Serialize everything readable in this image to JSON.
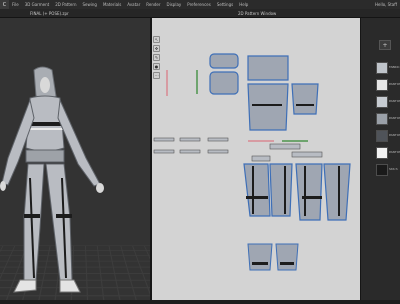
{
  "menubar": {
    "logo": "C",
    "items": [
      "File",
      "3D Garment",
      "2D Pattern",
      "Sewing",
      "Materials",
      "Avatar",
      "Render",
      "Display",
      "Preferences",
      "Settings",
      "Help"
    ],
    "user": "Hello, Staff"
  },
  "toolbar": {
    "file_name": "FINAL (+ POSE).zpr",
    "window_label": "2D Pattern Window"
  },
  "panel": {
    "top_button": "+",
    "swatches": [
      {
        "label": "FABRIC",
        "color": "#bfc4ca"
      },
      {
        "label": "PANTONE",
        "color": "#e6e6e6"
      },
      {
        "label": "PANTONE",
        "color": "#c7ccd2"
      },
      {
        "label": "PANTONE",
        "color": "#9aa0a8"
      },
      {
        "label": "PANTONE",
        "color": "#4f5359"
      },
      {
        "label": "PANTONE",
        "color": "#f2f2f2"
      },
      {
        "label": "Stitch",
        "color": "#1a1a1a"
      }
    ]
  },
  "colors": {
    "garment": "#b9bcc2",
    "pattern_fill": "#9fa6b2",
    "pattern_outline": "#3e6fb7",
    "accent_black": "#1c1c1c",
    "trim_pink": "#d79ba2",
    "trim_green": "#6ea46e"
  }
}
